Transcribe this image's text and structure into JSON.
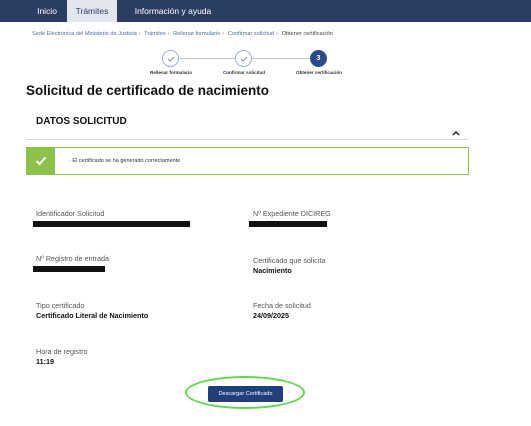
{
  "topnav": {
    "items": [
      "Inicio",
      "Trámites",
      "Información y ayuda"
    ],
    "active": "Trámites"
  },
  "breadcrumb": {
    "items": [
      "Sede Electrónica del Ministerio de Justicia",
      "Trámites",
      "Rellenar formulario",
      "Confirmar solicitud"
    ],
    "current": "Obtener certificación",
    "separator": "›"
  },
  "stepper": {
    "steps": [
      {
        "label": "Rellenar formulario",
        "state": "done",
        "icon": "check-icon"
      },
      {
        "label": "Confirmar solicitud",
        "state": "done",
        "icon": "check-icon"
      },
      {
        "label": "Obtener certificación",
        "state": "active",
        "number": "3"
      }
    ]
  },
  "page": {
    "title": "Solicitud de certificado de nacimiento"
  },
  "section": {
    "title": "DATOS SOLICITUD",
    "chevron": "⌃"
  },
  "alert": {
    "icon": "check-icon",
    "check_glyph": "✔",
    "text": "· El certificado se ha generado correctamente",
    "color": "#8bc34a"
  },
  "fields": {
    "identificador_label": "Identificador Solicitud",
    "expediente_label": "Nº Expediente DICIREG",
    "registro_label": "Nº Registro de entrada",
    "certificado_label": "Certificado que solicita",
    "certificado_value": "Nacimiento",
    "tipo_label": "Tipo certificado",
    "tipo_value": "Certificado Literal de Nacimiento",
    "fecha_label": "Fecha de solicitud",
    "fecha_value": "24/09/2025",
    "hora_label": "Hora de registro",
    "hora_value": "11:19"
  },
  "download": {
    "label": "Descargar Certificado"
  },
  "colors": {
    "nav_bg": "#2b3d63",
    "button_bg": "#213f7a",
    "success": "#8bc34a",
    "highlight": "#5fd84a"
  }
}
